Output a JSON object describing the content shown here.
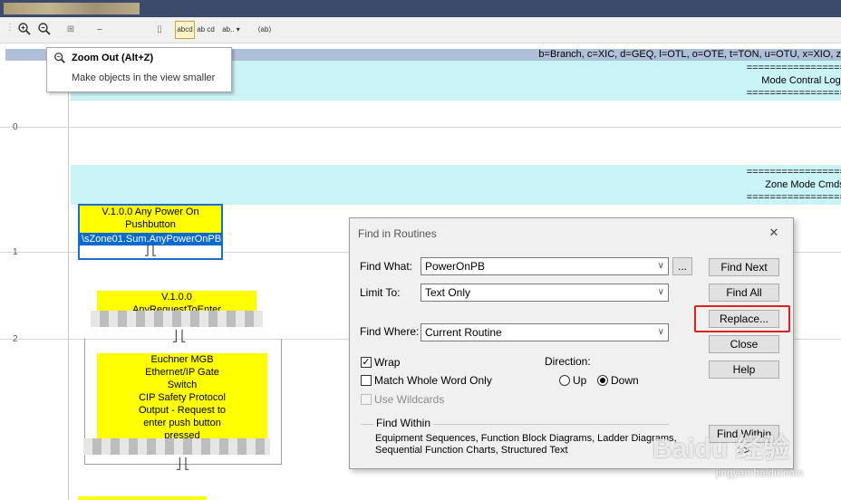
{
  "toolbar": {
    "buttons": [
      {
        "name": "zoom-in",
        "glyph": "🔍︎+"
      },
      {
        "name": "zoom-out",
        "glyph": "🔍︎−"
      },
      {
        "name": "text-abcd",
        "glyph": "abcd"
      },
      {
        "name": "text-ab-cd",
        "glyph": "ab cd"
      },
      {
        "name": "text-ab-dropdown",
        "glyph": "ab.."
      },
      {
        "name": "text-ab-tag",
        "glyph": "⟨ab⟩"
      }
    ]
  },
  "legend": "b=Branch, c=XIC, d=GEQ, l=OTL, o=OTE, t=TON, u=OTU, x=XIO, z",
  "tooltip": {
    "title": "Zoom Out (Alt+Z)",
    "description": "Make objects in the view smaller"
  },
  "comments": [
    {
      "line1": "====================",
      "line2": "Mode Contral Logic",
      "line3": "===================="
    },
    {
      "line1": "====================",
      "line2": "Zone Mode Cmds",
      "line3": "===================="
    }
  ],
  "row_numbers": [
    "0",
    "1",
    "2"
  ],
  "rung1": {
    "line1": "V.1.0.0 Any Power On",
    "line2": "Pushbutton",
    "tag": "\\sZone01.Sum.AnyPowerOnPB"
  },
  "rung2a": {
    "line1": "V.1.0.0",
    "line2": "AnyRequestToEnter"
  },
  "rung2b": {
    "lines": [
      "Euchner MGB",
      "Ethernet/IP Gate",
      "Switch",
      "CIP Safety Protocol",
      "Output - Request to",
      "enter push button",
      "pressed"
    ]
  },
  "dialog": {
    "title": "Find in Routines",
    "close_glyph": "✕",
    "find_what_label": "Find What:",
    "find_what_value": "PowerOnPB",
    "browse_label": "...",
    "limit_to_label": "Limit To:",
    "limit_to_value": "Text Only",
    "find_where_label": "Find Where:",
    "find_where_value": "Current Routine",
    "wrap_label": "Wrap",
    "wrap_checked": true,
    "match_whole_label": "Match Whole Word Only",
    "wildcards_label": "Use Wildcards",
    "direction_label": "Direction:",
    "up_label": "Up",
    "down_label": "Down",
    "find_within_label": "Find Within",
    "find_within_line1": "Equipment Sequences, Function Block Diagrams, Ladder Diagrams,",
    "find_within_line2": "Sequential Function Charts, Structured Text",
    "buttons": {
      "find_next": "Find Next",
      "find_all": "Find All",
      "replace": "Replace...",
      "close": "Close",
      "help": "Help",
      "find_within": "Find Within >>"
    },
    "highlight_color": "#e0201c"
  },
  "watermark": {
    "brand": "Baidu 经验",
    "url": "jingyan.baidu.com"
  }
}
